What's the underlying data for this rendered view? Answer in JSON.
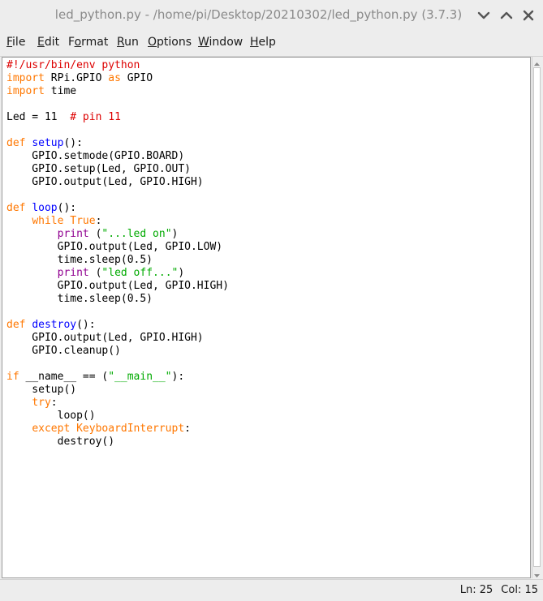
{
  "window": {
    "title": "led_python.py - /home/pi/Desktop/20210302/led_python.py (3.7.3)"
  },
  "menu": [
    {
      "mnemonic": "F",
      "rest": "ile"
    },
    {
      "mnemonic": "E",
      "rest": "dit"
    },
    {
      "mnemonic": "",
      "pre": "F",
      "mid": "o",
      "rest": "rmat"
    },
    {
      "mnemonic": "R",
      "rest": "un"
    },
    {
      "mnemonic": "O",
      "rest": "ptions"
    },
    {
      "mnemonic": "W",
      "rest": "indow"
    },
    {
      "mnemonic": "H",
      "rest": "elp"
    }
  ],
  "menu_labels": [
    "File",
    "Edit",
    "Format",
    "Run",
    "Options",
    "Window",
    "Help"
  ],
  "code": [
    [
      [
        "comment",
        "#!/usr/bin/env python"
      ]
    ],
    [
      [
        "keyword",
        "import"
      ],
      [
        "plain",
        " RPi.GPIO "
      ],
      [
        "keyword",
        "as"
      ],
      [
        "plain",
        " GPIO"
      ]
    ],
    [
      [
        "keyword",
        "import"
      ],
      [
        "plain",
        " time"
      ]
    ],
    [],
    [
      [
        "plain",
        "Led = 11  "
      ],
      [
        "comment",
        "# pin 11"
      ]
    ],
    [],
    [
      [
        "keyword",
        "def"
      ],
      [
        "plain",
        " "
      ],
      [
        "def",
        "setup"
      ],
      [
        "plain",
        "():"
      ]
    ],
    [
      [
        "plain",
        "    GPIO.setmode(GPIO.BOARD)"
      ]
    ],
    [
      [
        "plain",
        "    GPIO.setup(Led, GPIO.OUT)"
      ]
    ],
    [
      [
        "plain",
        "    GPIO.output(Led, GPIO.HIGH)"
      ]
    ],
    [],
    [
      [
        "keyword",
        "def"
      ],
      [
        "plain",
        " "
      ],
      [
        "def",
        "loop"
      ],
      [
        "plain",
        "():"
      ]
    ],
    [
      [
        "plain",
        "    "
      ],
      [
        "keyword",
        "while"
      ],
      [
        "plain",
        " "
      ],
      [
        "keyword",
        "True"
      ],
      [
        "plain",
        ":"
      ]
    ],
    [
      [
        "plain",
        "        "
      ],
      [
        "builtin",
        "print"
      ],
      [
        "plain",
        " ("
      ],
      [
        "string",
        "\"...led on\""
      ],
      [
        "plain",
        ")"
      ]
    ],
    [
      [
        "plain",
        "        GPIO.output(Led, GPIO.LOW)"
      ]
    ],
    [
      [
        "plain",
        "        time.sleep(0.5)"
      ]
    ],
    [
      [
        "plain",
        "        "
      ],
      [
        "builtin",
        "print"
      ],
      [
        "plain",
        " ("
      ],
      [
        "string",
        "\"led off...\""
      ],
      [
        "plain",
        ")"
      ]
    ],
    [
      [
        "plain",
        "        GPIO.output(Led, GPIO.HIGH)"
      ]
    ],
    [
      [
        "plain",
        "        time.sleep(0.5)"
      ]
    ],
    [],
    [
      [
        "keyword",
        "def"
      ],
      [
        "plain",
        " "
      ],
      [
        "def",
        "destroy"
      ],
      [
        "plain",
        "():"
      ]
    ],
    [
      [
        "plain",
        "    GPIO.output(Led, GPIO.HIGH)"
      ]
    ],
    [
      [
        "plain",
        "    GPIO.cleanup()"
      ]
    ],
    [],
    [
      [
        "keyword",
        "if"
      ],
      [
        "plain",
        " __name__ == ("
      ],
      [
        "string",
        "\"__main__\""
      ],
      [
        "plain",
        "):"
      ]
    ],
    [
      [
        "plain",
        "    setup()"
      ]
    ],
    [
      [
        "plain",
        "    "
      ],
      [
        "keyword",
        "try"
      ],
      [
        "plain",
        ":"
      ]
    ],
    [
      [
        "plain",
        "        loop()"
      ]
    ],
    [
      [
        "plain",
        "    "
      ],
      [
        "keyword",
        "except"
      ],
      [
        "plain",
        " "
      ],
      [
        "keyword",
        "KeyboardInterrupt"
      ],
      [
        "plain",
        ":"
      ]
    ],
    [
      [
        "plain",
        "        destroy()"
      ]
    ]
  ],
  "status": {
    "line": "Ln: 25",
    "col": "Col: 15"
  },
  "colors": {
    "comment": "#dd0000",
    "keyword": "#ff7700",
    "builtin": "#900090",
    "string": "#00aa00",
    "def": "#0000ff"
  },
  "icons": [
    "chevron-down-icon",
    "chevron-up-icon",
    "close-icon",
    "scroll-up-arrow-icon",
    "scroll-down-arrow-icon"
  ]
}
